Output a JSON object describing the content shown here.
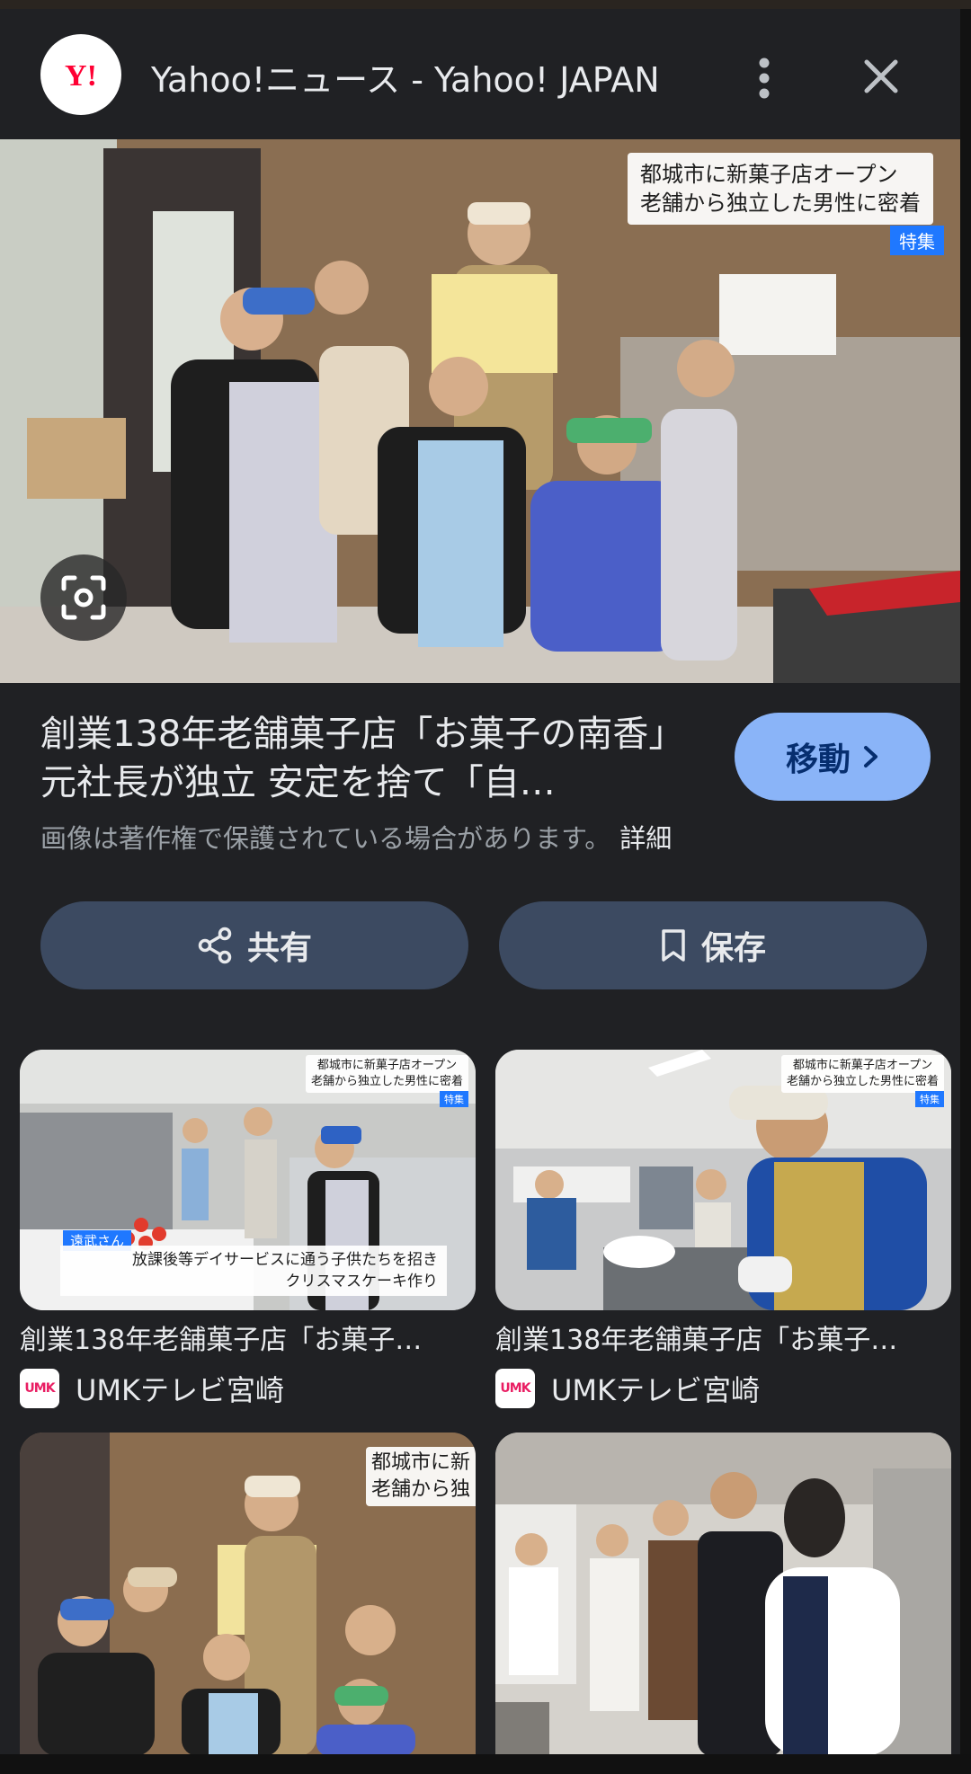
{
  "header": {
    "site_title": "Yahoo!ニュース - Yahoo! JAPAN",
    "logo_text": "Y!",
    "icons": [
      "more-vert-icon",
      "close-icon"
    ]
  },
  "hero": {
    "caption_line1": "都城市に新菓子店オープン",
    "caption_line2": "老舗から独立した男性に密着",
    "caption_tag": "特集"
  },
  "article": {
    "title": "創業138年老舗菓子店「お菓子の南香」元社長が独立 安定を捨て「自…",
    "copyright": "画像は著作権で保護されている場合があります。",
    "detail_link": "詳細",
    "visit_label": "移動"
  },
  "actions": {
    "share_label": "共有",
    "save_label": "保存"
  },
  "related": [
    {
      "title": "創業138年老舗菓子店「お菓子…",
      "source": "UMKテレビ宮崎",
      "caption_line1": "都城市に新菓子店オープン",
      "caption_line2": "老舗から独立した男性に密着",
      "tag": "特集",
      "name_tag": "遠武さん",
      "lower_line1": "放課後等デイサービスに通う子供たちを招き",
      "lower_line2": "クリスマスケーキ作り"
    },
    {
      "title": "創業138年老舗菓子店「お菓子…",
      "source": "UMKテレビ宮崎",
      "caption_line1": "都城市に新菓子店オープン",
      "caption_line2": "老舗から独立した男性に密着",
      "tag": "特集"
    },
    {
      "caption_line1": "都城市に新",
      "caption_line2": "老舗から独"
    },
    {}
  ],
  "source_icon_text": "UMK",
  "colors": {
    "background": "#202124",
    "accent": "#8ab4f8",
    "action_button": "#3c4a61",
    "tag_blue": "#1f78ff"
  }
}
